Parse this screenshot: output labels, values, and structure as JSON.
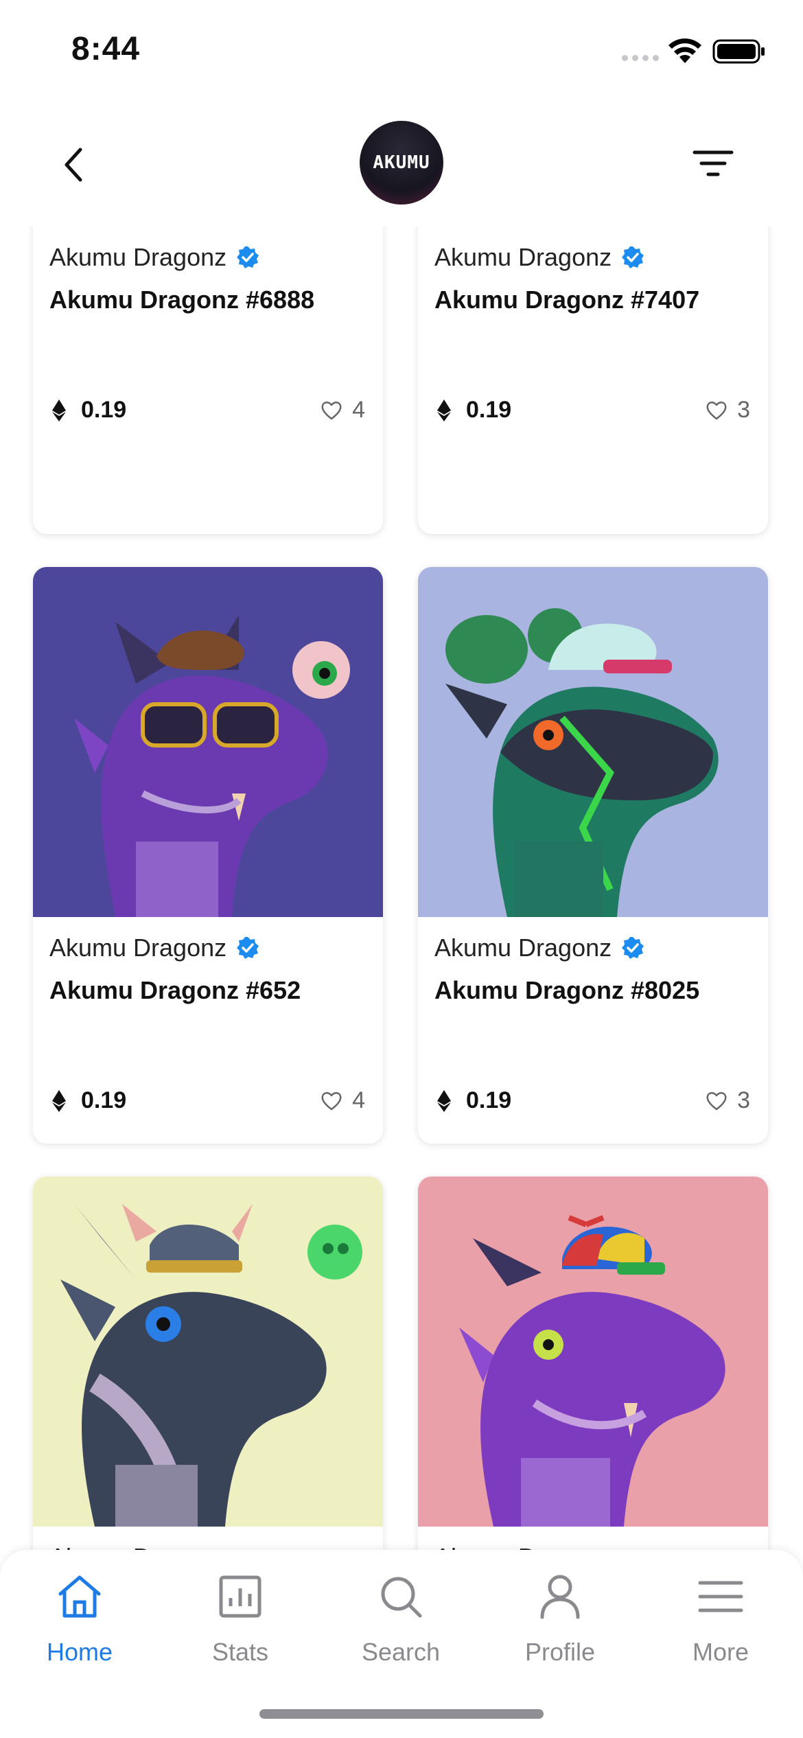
{
  "status_bar": {
    "time": "8:44"
  },
  "header": {
    "logo_text": "AKUMU"
  },
  "colors": {
    "accent": "#1e7be6",
    "verified": "#1d8cf0"
  },
  "cards": [
    {
      "collection": "Akumu Dragonz",
      "name": "Akumu Dragonz #6888",
      "price": "0.19",
      "likes": "4",
      "bg": "#a98fc7"
    },
    {
      "collection": "Akumu Dragonz",
      "name": "Akumu Dragonz #7407",
      "price": "0.19",
      "likes": "3",
      "bg": "#f0ae4c"
    },
    {
      "collection": "Akumu Dragonz",
      "name": "Akumu Dragonz #652",
      "price": "0.19",
      "likes": "4",
      "bg": "#4c479a"
    },
    {
      "collection": "Akumu Dragonz",
      "name": "Akumu Dragonz #8025",
      "price": "0.19",
      "likes": "3",
      "bg": "#aab4e0"
    },
    {
      "collection": "Akumu Dragonz",
      "name": "",
      "price": "",
      "likes": "",
      "bg": "#eff0c2"
    },
    {
      "collection": "Akumu Dragonz",
      "name": "",
      "price": "",
      "likes": "",
      "bg": "#e9a0a8"
    }
  ],
  "tabs": [
    {
      "label": "Home",
      "icon": "home-icon",
      "active": true
    },
    {
      "label": "Stats",
      "icon": "stats-icon",
      "active": false
    },
    {
      "label": "Search",
      "icon": "search-icon",
      "active": false
    },
    {
      "label": "Profile",
      "icon": "profile-icon",
      "active": false
    },
    {
      "label": "More",
      "icon": "menu-icon",
      "active": false
    }
  ]
}
